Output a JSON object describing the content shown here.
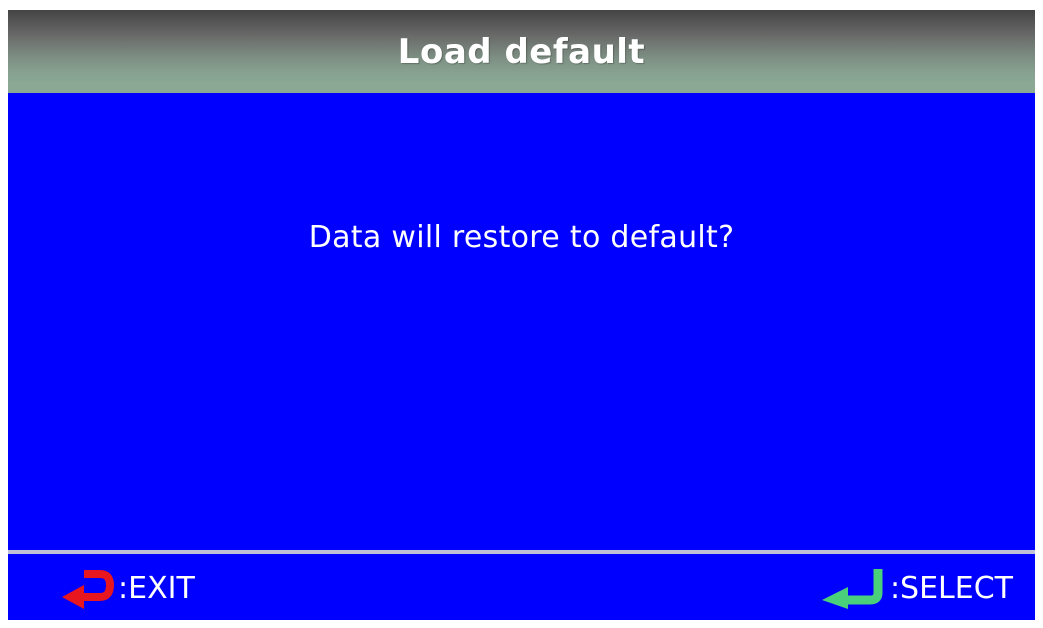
{
  "header": {
    "title": "Load default"
  },
  "dialog": {
    "message": "Data will restore to default?"
  },
  "footer": {
    "exit": {
      "icon": "return-arrow-icon",
      "icon_color": "#e8161e",
      "label": ":EXIT"
    },
    "select": {
      "icon": "enter-arrow-icon",
      "icon_color": "#4ad07a",
      "label": ":SELECT"
    }
  },
  "colors": {
    "background": "#0000ff",
    "text": "#ffffff",
    "divider": "#c0c0d8"
  }
}
